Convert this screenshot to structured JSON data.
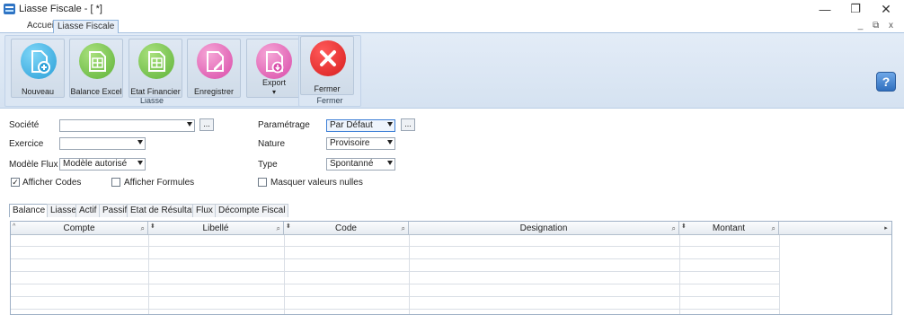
{
  "window": {
    "title": "Liasse Fiscale - [ *]",
    "minimize": "—",
    "maximize": "❐",
    "close": "✕"
  },
  "top_tabs": [
    {
      "label": "Accueil"
    },
    {
      "label": "Liasse Fiscale"
    }
  ],
  "mdi_controls": "_ ⧉ x",
  "ribbon": {
    "groups": [
      {
        "label": "Liasse"
      },
      {
        "label": "Fermer"
      }
    ],
    "buttons": {
      "nouveau": "Nouveau",
      "balance_excel": "Balance Excel",
      "etat_financier": "Etat Financier",
      "enregistrer": "Enregistrer",
      "export": "Export",
      "fermer": "Fermer"
    },
    "help": "?"
  },
  "form": {
    "societe": {
      "label": "Société",
      "value": ""
    },
    "exercice": {
      "label": "Exercice",
      "value": ""
    },
    "modele_flux": {
      "label": "Modèle Flux",
      "value": "Modèle autorisé"
    },
    "parametrage": {
      "label": "Paramétrage",
      "value": "Par Défaut"
    },
    "nature": {
      "label": "Nature",
      "value": "Provisoire"
    },
    "type": {
      "label": "Type",
      "value": "Spontanné"
    },
    "ellipsis": "...",
    "afficher_codes": {
      "label": "Afficher Codes",
      "checked": true,
      "mark": "✓"
    },
    "afficher_formules": {
      "label": "Afficher Formules",
      "checked": false
    },
    "masquer_valeurs_nulles": {
      "label": "Masquer valeurs nulles",
      "checked": false
    }
  },
  "bottom_tabs": [
    {
      "label": "Balance"
    },
    {
      "label": "Liasse"
    },
    {
      "label": "Actif"
    },
    {
      "label": "Passif"
    },
    {
      "label": "Etat de Résultat"
    },
    {
      "label": "Flux"
    },
    {
      "label": "Décompte Fiscal"
    }
  ],
  "grid": {
    "columns": [
      {
        "label": "Compte"
      },
      {
        "label": "Libellé"
      },
      {
        "label": "Code"
      },
      {
        "label": "Designation"
      },
      {
        "label": "Montant"
      }
    ],
    "rows": []
  }
}
